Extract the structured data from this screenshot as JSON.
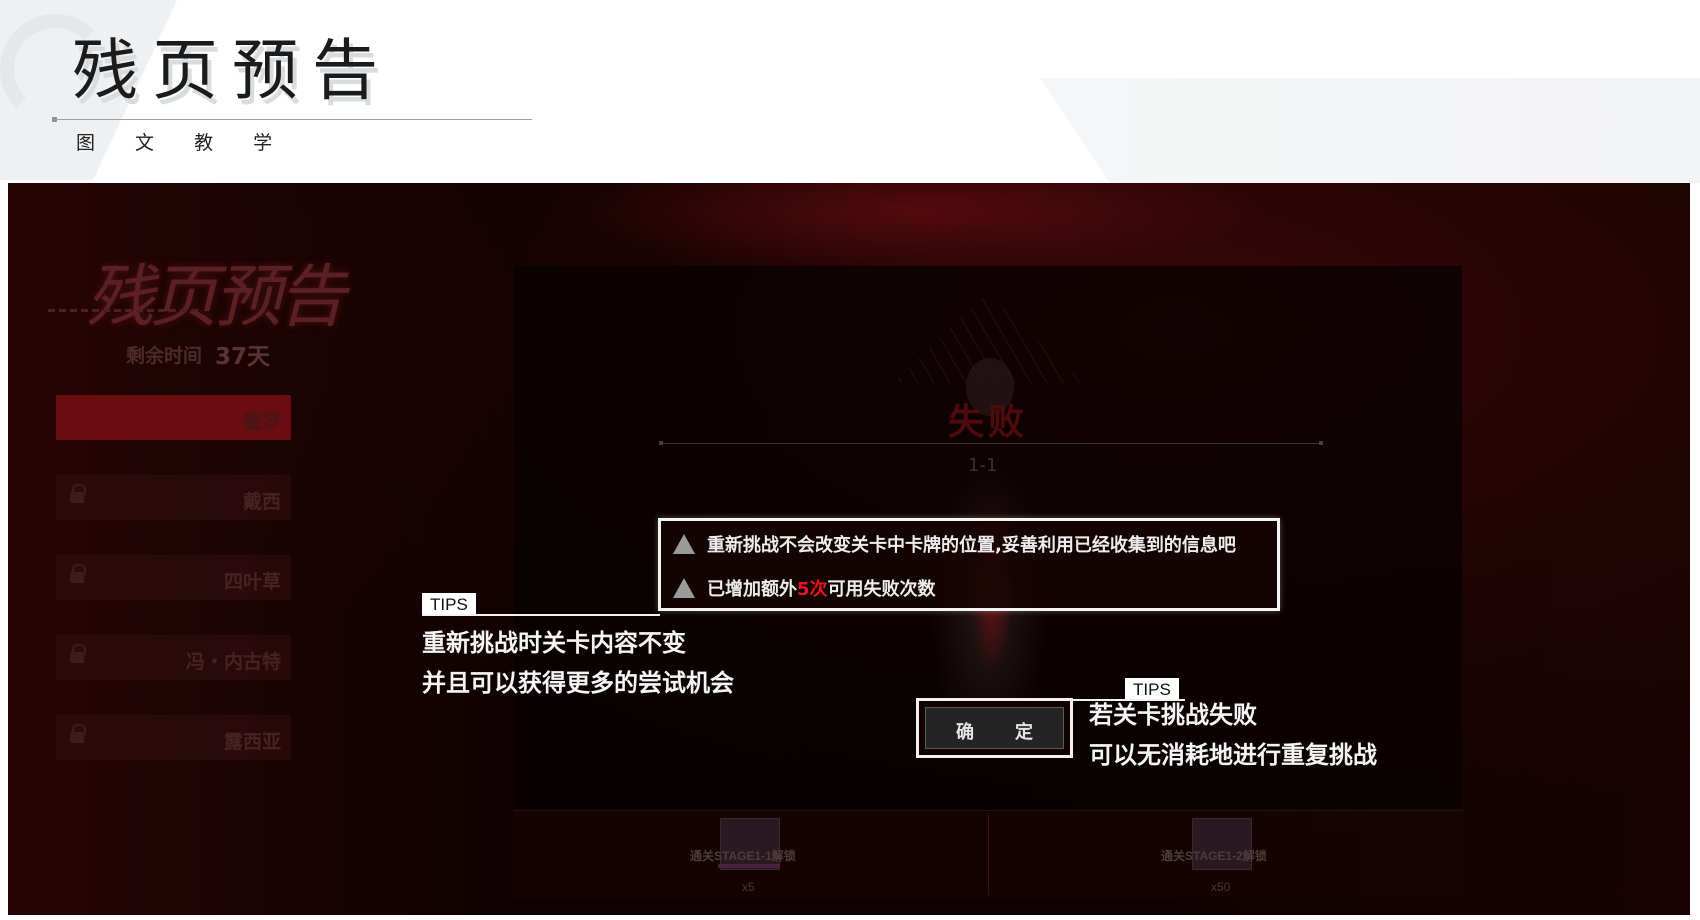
{
  "header": {
    "title": "残页预告",
    "subtitle": "图 文 教 学"
  },
  "event": {
    "logo_text": "残页预告",
    "time_label": "剩余时间",
    "time_value": "37天"
  },
  "sidebar": {
    "items": [
      {
        "label": "噩梦",
        "locked": false,
        "active": true
      },
      {
        "label": "戴西",
        "locked": true,
        "active": false
      },
      {
        "label": "四叶草",
        "locked": true,
        "active": false
      },
      {
        "label": "冯・内古特",
        "locked": true,
        "active": false
      },
      {
        "label": "露西亚",
        "locked": true,
        "active": false
      }
    ]
  },
  "result": {
    "title": "失败",
    "stage": "1-1"
  },
  "tip_box": {
    "line1": "重新挑战不会改变关卡中卡牌的位置,妥善利用已经收集到的信息吧",
    "line2_before": "已增加额外",
    "line2_highlight": "5次",
    "line2_after": "可用失败次数",
    "highlight_color": "#e3151d"
  },
  "confirm": {
    "char1": "确",
    "char2": "定"
  },
  "annotations": {
    "tag": "TIPS",
    "left_caption_line1": "重新挑战时关卡内容不变",
    "left_caption_line2": "并且可以获得更多的尝试机会",
    "right_caption_line1": "若关卡挑战失败",
    "right_caption_line2": "可以无消耗地进行重复挑战"
  },
  "rewards": [
    {
      "label": "通关STAGE1-1解锁",
      "count": "x5"
    },
    {
      "label": "通关STAGE1-2解锁",
      "count": "x50"
    }
  ]
}
